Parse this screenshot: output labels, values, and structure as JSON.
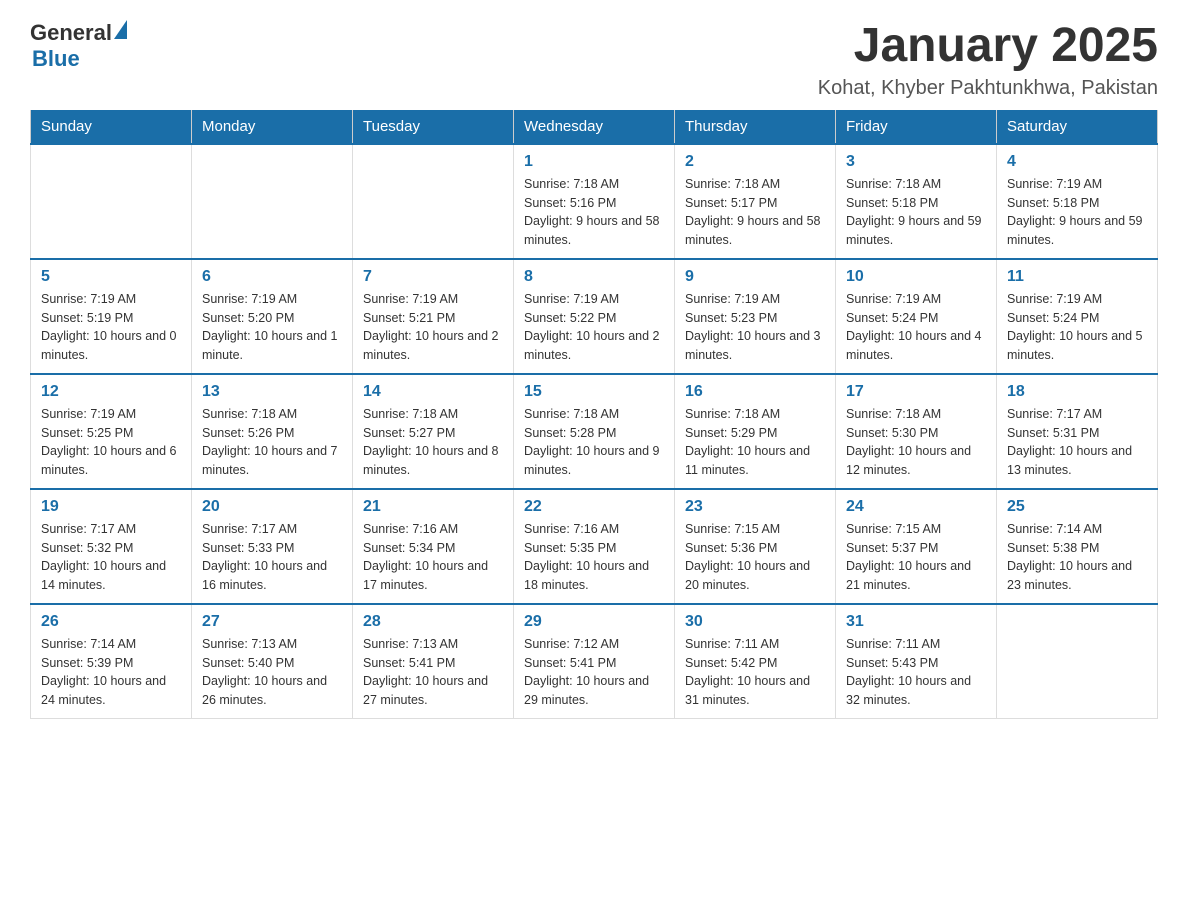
{
  "header": {
    "logo_general": "General",
    "logo_blue": "Blue",
    "month_title": "January 2025",
    "location": "Kohat, Khyber Pakhtunkhwa, Pakistan"
  },
  "days_of_week": [
    "Sunday",
    "Monday",
    "Tuesday",
    "Wednesday",
    "Thursday",
    "Friday",
    "Saturday"
  ],
  "weeks": [
    {
      "days": [
        {
          "number": "",
          "info": ""
        },
        {
          "number": "",
          "info": ""
        },
        {
          "number": "",
          "info": ""
        },
        {
          "number": "1",
          "info": "Sunrise: 7:18 AM\nSunset: 5:16 PM\nDaylight: 9 hours\nand 58 minutes."
        },
        {
          "number": "2",
          "info": "Sunrise: 7:18 AM\nSunset: 5:17 PM\nDaylight: 9 hours\nand 58 minutes."
        },
        {
          "number": "3",
          "info": "Sunrise: 7:18 AM\nSunset: 5:18 PM\nDaylight: 9 hours\nand 59 minutes."
        },
        {
          "number": "4",
          "info": "Sunrise: 7:19 AM\nSunset: 5:18 PM\nDaylight: 9 hours\nand 59 minutes."
        }
      ]
    },
    {
      "days": [
        {
          "number": "5",
          "info": "Sunrise: 7:19 AM\nSunset: 5:19 PM\nDaylight: 10 hours\nand 0 minutes."
        },
        {
          "number": "6",
          "info": "Sunrise: 7:19 AM\nSunset: 5:20 PM\nDaylight: 10 hours\nand 1 minute."
        },
        {
          "number": "7",
          "info": "Sunrise: 7:19 AM\nSunset: 5:21 PM\nDaylight: 10 hours\nand 2 minutes."
        },
        {
          "number": "8",
          "info": "Sunrise: 7:19 AM\nSunset: 5:22 PM\nDaylight: 10 hours\nand 2 minutes."
        },
        {
          "number": "9",
          "info": "Sunrise: 7:19 AM\nSunset: 5:23 PM\nDaylight: 10 hours\nand 3 minutes."
        },
        {
          "number": "10",
          "info": "Sunrise: 7:19 AM\nSunset: 5:24 PM\nDaylight: 10 hours\nand 4 minutes."
        },
        {
          "number": "11",
          "info": "Sunrise: 7:19 AM\nSunset: 5:24 PM\nDaylight: 10 hours\nand 5 minutes."
        }
      ]
    },
    {
      "days": [
        {
          "number": "12",
          "info": "Sunrise: 7:19 AM\nSunset: 5:25 PM\nDaylight: 10 hours\nand 6 minutes."
        },
        {
          "number": "13",
          "info": "Sunrise: 7:18 AM\nSunset: 5:26 PM\nDaylight: 10 hours\nand 7 minutes."
        },
        {
          "number": "14",
          "info": "Sunrise: 7:18 AM\nSunset: 5:27 PM\nDaylight: 10 hours\nand 8 minutes."
        },
        {
          "number": "15",
          "info": "Sunrise: 7:18 AM\nSunset: 5:28 PM\nDaylight: 10 hours\nand 9 minutes."
        },
        {
          "number": "16",
          "info": "Sunrise: 7:18 AM\nSunset: 5:29 PM\nDaylight: 10 hours\nand 11 minutes."
        },
        {
          "number": "17",
          "info": "Sunrise: 7:18 AM\nSunset: 5:30 PM\nDaylight: 10 hours\nand 12 minutes."
        },
        {
          "number": "18",
          "info": "Sunrise: 7:17 AM\nSunset: 5:31 PM\nDaylight: 10 hours\nand 13 minutes."
        }
      ]
    },
    {
      "days": [
        {
          "number": "19",
          "info": "Sunrise: 7:17 AM\nSunset: 5:32 PM\nDaylight: 10 hours\nand 14 minutes."
        },
        {
          "number": "20",
          "info": "Sunrise: 7:17 AM\nSunset: 5:33 PM\nDaylight: 10 hours\nand 16 minutes."
        },
        {
          "number": "21",
          "info": "Sunrise: 7:16 AM\nSunset: 5:34 PM\nDaylight: 10 hours\nand 17 minutes."
        },
        {
          "number": "22",
          "info": "Sunrise: 7:16 AM\nSunset: 5:35 PM\nDaylight: 10 hours\nand 18 minutes."
        },
        {
          "number": "23",
          "info": "Sunrise: 7:15 AM\nSunset: 5:36 PM\nDaylight: 10 hours\nand 20 minutes."
        },
        {
          "number": "24",
          "info": "Sunrise: 7:15 AM\nSunset: 5:37 PM\nDaylight: 10 hours\nand 21 minutes."
        },
        {
          "number": "25",
          "info": "Sunrise: 7:14 AM\nSunset: 5:38 PM\nDaylight: 10 hours\nand 23 minutes."
        }
      ]
    },
    {
      "days": [
        {
          "number": "26",
          "info": "Sunrise: 7:14 AM\nSunset: 5:39 PM\nDaylight: 10 hours\nand 24 minutes."
        },
        {
          "number": "27",
          "info": "Sunrise: 7:13 AM\nSunset: 5:40 PM\nDaylight: 10 hours\nand 26 minutes."
        },
        {
          "number": "28",
          "info": "Sunrise: 7:13 AM\nSunset: 5:41 PM\nDaylight: 10 hours\nand 27 minutes."
        },
        {
          "number": "29",
          "info": "Sunrise: 7:12 AM\nSunset: 5:41 PM\nDaylight: 10 hours\nand 29 minutes."
        },
        {
          "number": "30",
          "info": "Sunrise: 7:11 AM\nSunset: 5:42 PM\nDaylight: 10 hours\nand 31 minutes."
        },
        {
          "number": "31",
          "info": "Sunrise: 7:11 AM\nSunset: 5:43 PM\nDaylight: 10 hours\nand 32 minutes."
        },
        {
          "number": "",
          "info": ""
        }
      ]
    }
  ]
}
